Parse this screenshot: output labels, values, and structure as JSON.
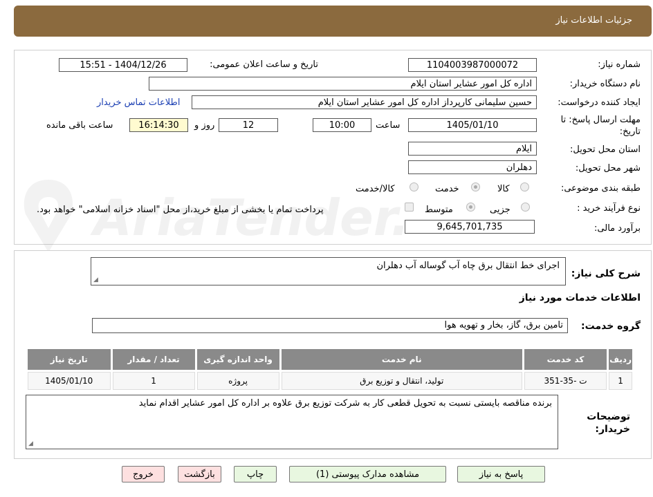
{
  "header": {
    "title": "جزئیات اطلاعات نیاز"
  },
  "form": {
    "need_number_label": "شماره نیاز:",
    "need_number": "1104003987000072",
    "announce_label": "تاریخ و ساعت اعلان عمومی:",
    "announce_value": "1404/12/26 - 15:51",
    "buyer_org_label": "نام دستگاه خریدار:",
    "buyer_org": "اداره کل امور عشایر استان ایلام",
    "requester_label": "ایجاد کننده درخواست:",
    "requester": "حسین سلیمانی کارپرداز اداره کل امور عشایر استان ایلام",
    "contact_link": "اطلاعات تماس خریدار",
    "deadline_label_1": "مهلت ارسال پاسخ: تا",
    "deadline_label_2": "تاریخ:",
    "deadline_date": "1405/01/10",
    "hour_label": "ساعت",
    "deadline_time": "10:00",
    "days": "12",
    "days_label": "روز و",
    "remaining_time": "16:14:30",
    "remaining_label": "ساعت باقی مانده",
    "province_label": "استان محل تحویل:",
    "province": "ایلام",
    "city_label": "شهر محل تحویل:",
    "city": "دهلران",
    "category_label": "طبقه بندی موضوعی:",
    "category_options": [
      "کالا",
      "خدمت",
      "کالا/خدمت"
    ],
    "process_label": "نوع فرآیند خرید :",
    "process_options": [
      "جزیی",
      "متوسط"
    ],
    "payment_note": "پرداخت تمام یا بخشی از مبلغ خرید،از محل \"اسناد خزانه اسلامی\" خواهد بود.",
    "budget_label": "برآورد مالی:",
    "budget": "9,645,701,735"
  },
  "summary": {
    "label": "شرح کلی نیاز:",
    "text": "اجرای خط انتقال برق چاه آب گوساله آب دهلران"
  },
  "services": {
    "section_title": "اطلاعات خدمات مورد نیاز",
    "group_label": "گروه خدمت:",
    "group_value": "تامین برق، گاز، بخار و تهویه هوا",
    "columns": [
      "ردیف",
      "کد خدمت",
      "نام خدمت",
      "واحد اندازه گیری",
      "تعداد / مقدار",
      "تاریخ نیاز"
    ],
    "rows": [
      [
        "1",
        "ت -35-351",
        "تولید، انتقال و توزیع برق",
        "پروژه",
        "1",
        "1405/01/10"
      ]
    ]
  },
  "buyer_notes": {
    "label_1": "توضیحات",
    "label_2": "خریدار:",
    "text": "برنده مناقصه بایستی نسبت به تحویل قطعی کار به شرکت توزیع برق علاوه بر اداره کل امور عشایر اقدام نماید"
  },
  "buttons": {
    "reply": "پاسخ به نیاز",
    "attachments": "مشاهده مدارک پیوستی (1)",
    "print": "چاپ",
    "back": "بازگشت",
    "exit": "خروج"
  },
  "watermark": {
    "text": "AriaTender.net"
  },
  "colors": {
    "header": "#8b6a3e",
    "link": "#1b3fb3",
    "table_header": "#8a8a8a"
  }
}
